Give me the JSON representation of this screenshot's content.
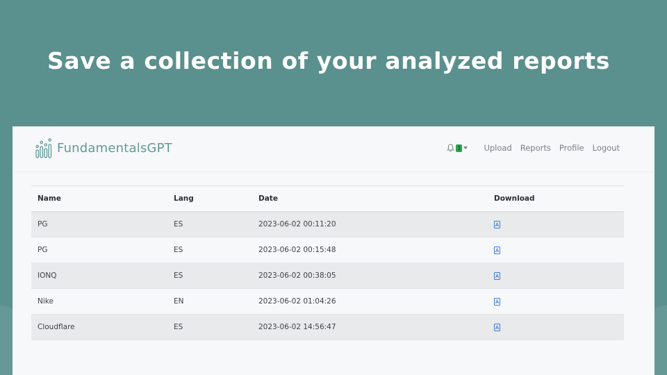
{
  "headline": "Save a collection of your analyzed reports",
  "app": {
    "brand": "FundamentalsGPT",
    "notifications": {
      "count": "1"
    },
    "nav": [
      "Upload",
      "Reports",
      "Profile",
      "Logout"
    ]
  },
  "table": {
    "columns": [
      "Name",
      "Lang",
      "Date",
      "Download"
    ],
    "rows": [
      {
        "name": "PG",
        "lang": "ES",
        "date": "2023-06-02 00:11:20"
      },
      {
        "name": "PG",
        "lang": "ES",
        "date": "2023-06-02 00:15:48"
      },
      {
        "name": "IONQ",
        "lang": "ES",
        "date": "2023-06-02 00:38:05"
      },
      {
        "name": "Nike",
        "lang": "EN",
        "date": "2023-06-02 01:04:26"
      },
      {
        "name": "Cloudflare",
        "lang": "ES",
        "date": "2023-06-02 14:56:47"
      }
    ]
  },
  "colors": {
    "background": "#5a908e",
    "brand": "#5f9a98",
    "badge": "#2ea44f",
    "link_icon": "#3b7bd6"
  },
  "icons": {
    "logo": "bar-chart-logo-icon",
    "bell": "bell-icon",
    "download": "pdf-file-icon"
  }
}
